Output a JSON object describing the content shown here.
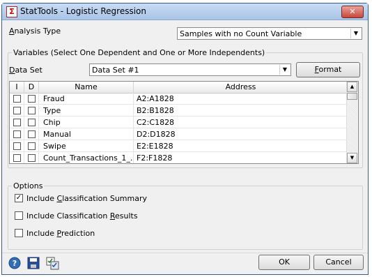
{
  "window": {
    "title": "StatTools - Logistic Regression"
  },
  "analysis_type": {
    "label_prefix": "",
    "label_accel": "A",
    "label_rest": "nalysis Type",
    "value": "Samples with no Count Variable"
  },
  "variables": {
    "legend": "Variables (Select One Dependent and One or More Independents)",
    "dataset_label": "Data Set",
    "dataset_accel": "D",
    "dataset_rest": "ata Set",
    "dataset_value": "Data Set #1",
    "format_accel": "F",
    "format_rest": "ormat",
    "columns": [
      "I",
      "D",
      "Name",
      "Address"
    ],
    "rows": [
      {
        "name": "Fraud",
        "address": "A2:A1828"
      },
      {
        "name": "Type",
        "address": "B2:B1828"
      },
      {
        "name": "Chip",
        "address": "C2:C1828"
      },
      {
        "name": "Manual",
        "address": "D2:D1828"
      },
      {
        "name": "Swipe",
        "address": "E2:E1828"
      },
      {
        "name": "Count_Transactions_1_...",
        "address": "F2:F1828"
      }
    ]
  },
  "options": {
    "legend": "Options",
    "items": [
      {
        "pre": "Include ",
        "accel": "C",
        "post": "lassification Summary",
        "checked": true
      },
      {
        "pre": "Include Classification ",
        "accel": "R",
        "post": "esults",
        "checked": false
      },
      {
        "pre": "Include ",
        "accel": "P",
        "post": "rediction",
        "checked": false
      }
    ]
  },
  "footer": {
    "ok": "OK",
    "cancel": "Cancel",
    "icons": [
      "help-icon",
      "save-icon",
      "checklist-icon"
    ]
  },
  "colors": {
    "title_bar": "#a9c4e7",
    "close_button": "#c9463a",
    "dialog_bg": "#f0f0f0"
  }
}
